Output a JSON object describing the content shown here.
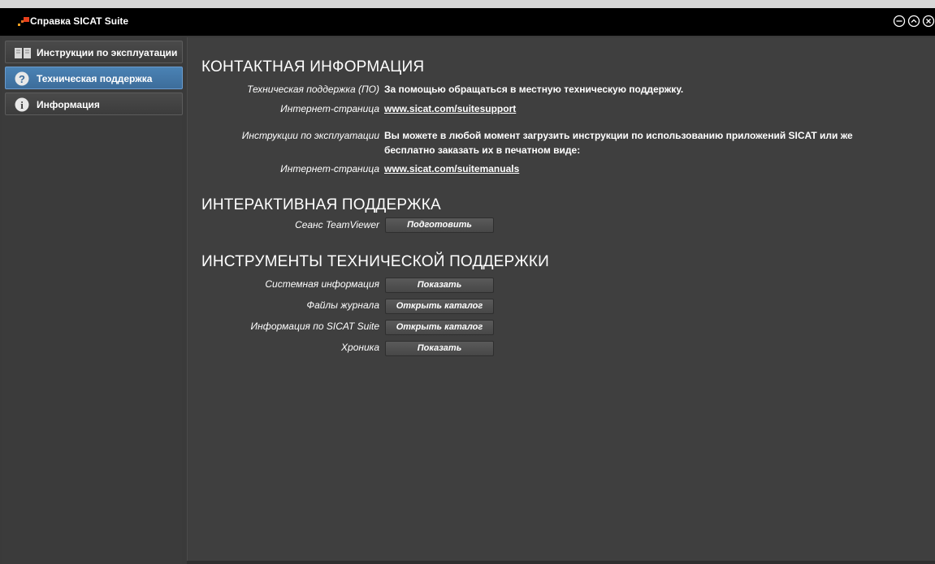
{
  "window": {
    "title": "Справка SICAT Suite",
    "controls": [
      "minimize-icon",
      "maximize-icon",
      "close-icon"
    ]
  },
  "sidebar": {
    "items": [
      {
        "label": "Инструкции по эксплуатации",
        "icon": "book-icon",
        "active": false
      },
      {
        "label": "Техническая поддержка",
        "icon": "question-icon",
        "active": true
      },
      {
        "label": "Информация",
        "icon": "info-icon",
        "active": false
      }
    ]
  },
  "contact": {
    "heading": "КОНТАКТНАЯ ИНФОРМАЦИЯ",
    "support_label": "Техническая поддержка (ПО)",
    "support_value": "За помощью обращаться в местную техническую поддержку.",
    "web1_label": "Интернет-страница",
    "web1_link": "www.sicat.com/suitesupport",
    "manuals_label": "Инструкции по эксплуатации",
    "manuals_line1": "Вы можете в любой момент загрузить инструкции по использованию приложений SICAT или же",
    "manuals_line2": "бесплатно заказать их в печатном виде:",
    "web2_label": "Интернет-страница",
    "web2_link": "www.sicat.com/suitemanuals"
  },
  "interactive": {
    "heading": "ИНТЕРАКТИВНАЯ ПОДДЕРЖКА",
    "teamviewer_label": "Сеанс TeamViewer",
    "teamviewer_button": "Подготовить"
  },
  "tools": {
    "heading": "ИНСТРУМЕНТЫ ТЕХНИЧЕСКОЙ ПОДДЕРЖКИ",
    "rows": [
      {
        "label": "Системная информация",
        "button": "Показать"
      },
      {
        "label": "Файлы журнала",
        "button": "Открыть каталог"
      },
      {
        "label": "Информация по SICAT Suite",
        "button": "Открыть каталог"
      },
      {
        "label": "Хроника",
        "button": "Показать"
      }
    ]
  }
}
